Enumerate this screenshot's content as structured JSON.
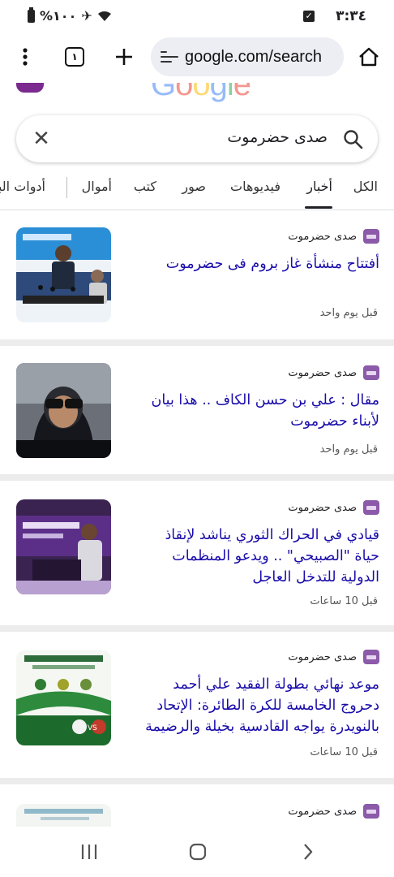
{
  "status_bar": {
    "time": "٣:٣٤",
    "battery": "%١٠٠"
  },
  "browser": {
    "tabs_count": "١",
    "url": "google.com/search"
  },
  "search": {
    "query": "صدى حضرموت"
  },
  "filter_tabs": [
    "الكل",
    "أخبار",
    "فيديوهات",
    "صور",
    "كتب",
    "أموال",
    "أدوات البحث"
  ],
  "results": [
    {
      "source": "صدى حضرموت",
      "headline": "أفتتاح منشأة غاز بروم فى حضرموت",
      "time": "قبل يوم واحد"
    },
    {
      "source": "صدى حضرموت",
      "headline": "مقال : علي بن حسن الكاف .. هذا بيان لأبناء حضرموت",
      "time": "قبل يوم واحد"
    },
    {
      "source": "صدى حضرموت",
      "headline": "قيادي في الحراك الثوري يناشد لإنقاذ حياة \"الصبيحي\" .. ويدعو المنظمات الدولية للتدخل العاجل",
      "time": "قبل 10 ساعات"
    },
    {
      "source": "صدى حضرموت",
      "headline": "موعد نهائي بطولة الفقيد علي أحمد دحروج الخامسة للكرة الطائرة: الإتحاد بالنويدرة يواجه القادسية بخيلة والرضيمة",
      "time": "قبل 10 ساعات"
    },
    {
      "source": "صدى حضرموت"
    }
  ]
}
